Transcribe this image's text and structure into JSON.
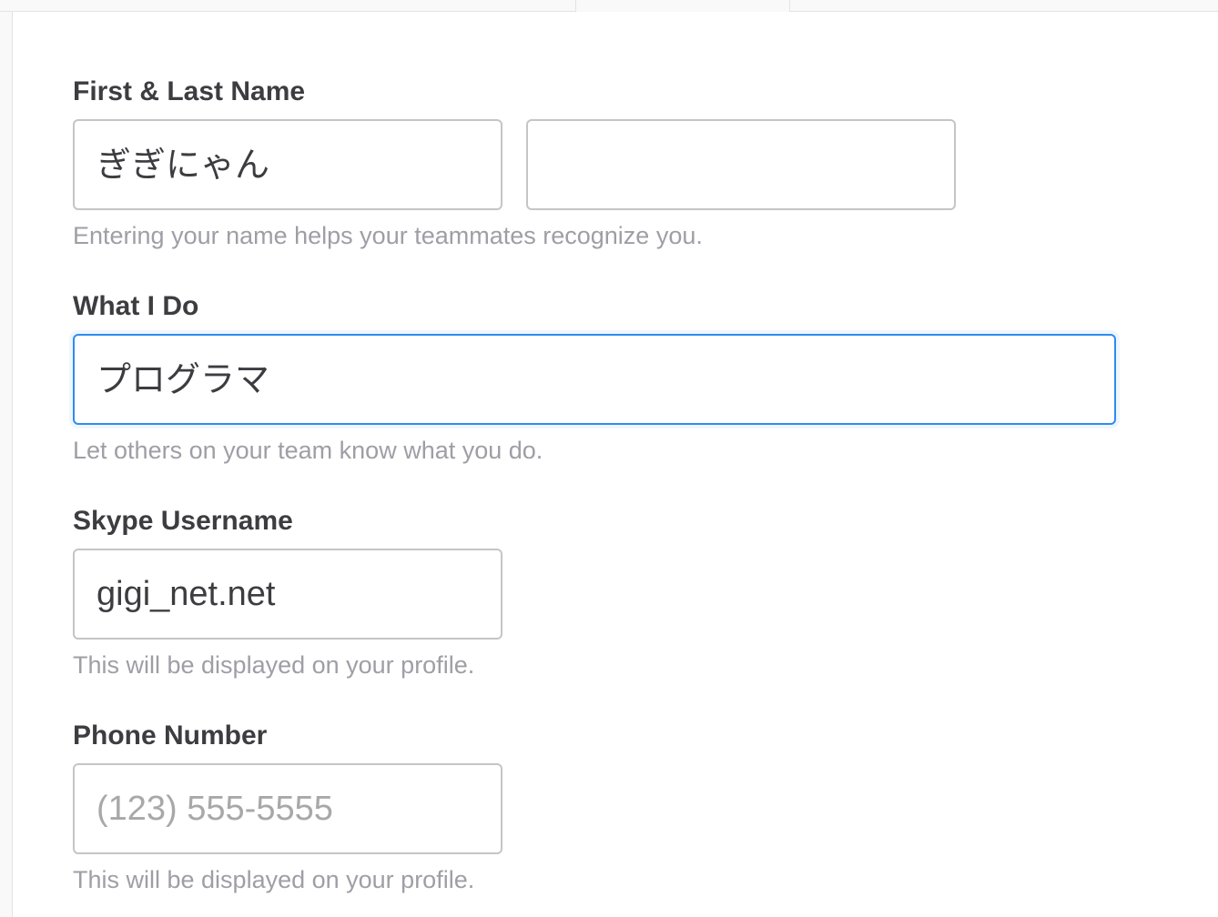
{
  "fields": {
    "name": {
      "label": "First & Last Name",
      "first_value": "ぎぎにゃん",
      "last_value": "",
      "hint": "Entering your name helps your teammates recognize you."
    },
    "what_i_do": {
      "label": "What I Do",
      "value": "プログラマ",
      "hint": "Let others on your team know what you do."
    },
    "skype": {
      "label": "Skype Username",
      "value": "gigi_net.net",
      "hint": "This will be displayed on your profile."
    },
    "phone": {
      "label": "Phone Number",
      "value": "",
      "placeholder": "(123) 555-5555",
      "hint": "This will be displayed on your profile."
    }
  },
  "colors": {
    "focus": "#2d8cf0",
    "label": "#3d3c40",
    "hint": "#9e9ea6"
  }
}
